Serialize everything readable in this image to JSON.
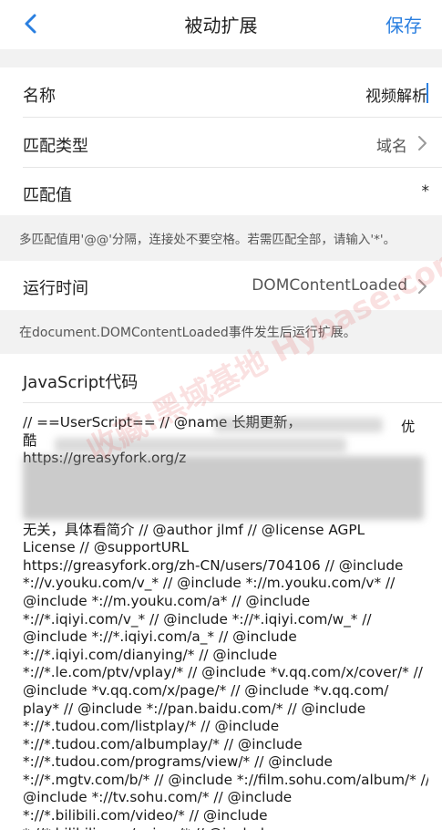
{
  "header": {
    "back_icon": "chevron-left-icon",
    "title": "被动扩展",
    "save_label": "保存",
    "accent": "#2a7fe0"
  },
  "form": {
    "name_label": "名称",
    "name_value": "视频解析",
    "match_type_label": "匹配类型",
    "match_type_value": "域名",
    "match_value_label": "匹配值",
    "match_value_value": "*",
    "match_hint": "多匹配值用'@@'分隔，连接处不要空格。若需匹配全部，请输入'*'。",
    "run_time_label": "运行时间",
    "run_time_value": "DOMContentLoaded",
    "run_time_hint": "在document.DOMContentLoaded事件发生后运行扩展。",
    "code_label": "JavaScript代码",
    "code_lines": [
      "// ==UserScript== // @name 长期更新，",
      "酷",
      "https://greasyfork.org/z",
      "",
      "",
      "",
      "无关，具体看简介 // @author jlmf // @license AGPL",
      "License // @supportURL",
      "https://greasyfork.org/zh-CN/users/704106 // @include",
      "*://v.youku.com/v_* // @include *://m.youku.com/v* //",
      "@include *://m.youku.com/a* // @include",
      "*://*.iqiyi.com/v_* // @include *://*.iqiyi.com/w_* //",
      "@include *://*.iqiyi.com/a_* // @include",
      "*://*.iqiyi.com/dianying/* // @include",
      "*://*.le.com/ptv/vplay/* // @include *v.qq.com/x/cover/* //",
      "@include *v.qq.com/x/page/* // @include *v.qq.com/",
      "play* // @include *://pan.baidu.com/* // @include",
      "*://*.tudou.com/listplay/* // @include",
      "*://*.tudou.com/albumplay/* // @include",
      "*://*.tudou.com/programs/view/* // @include",
      "*://*.mgtv.com/b/* // @include *://film.sohu.com/album/* //",
      "@include *://tv.sohu.com/* // @include",
      "*://*.bilibili.com/video/* // @include",
      "*://*.bilibili.com/anime/* // @include"
    ],
    "code_tail_first_line": "优"
  },
  "watermark": "收藏:黑域基地 Hybase.com",
  "chevron_icon": "chevron-right-icon"
}
